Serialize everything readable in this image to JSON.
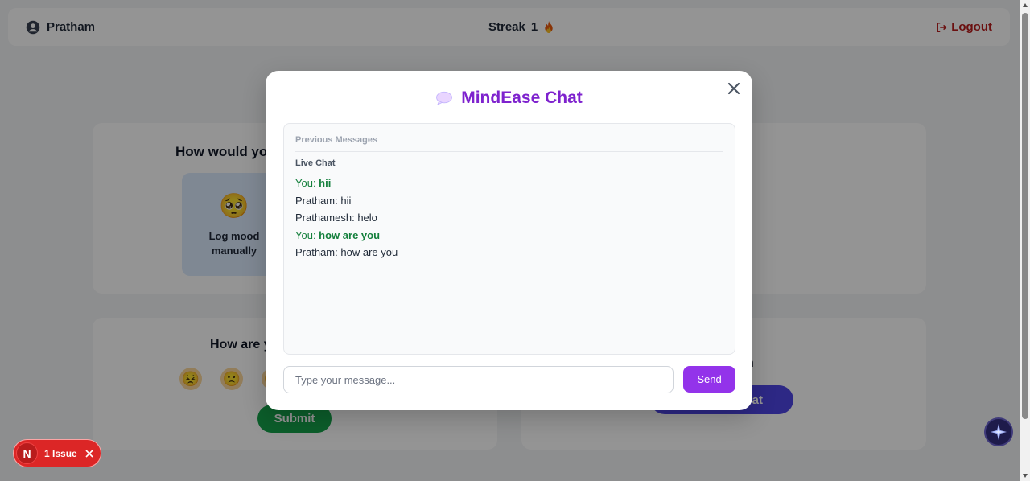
{
  "navbar": {
    "username": "Pratham",
    "streak_label": "Streak",
    "streak_count": "1",
    "streak_icon": "fire-icon",
    "logout_label": "Logout"
  },
  "mood_card": {
    "title": "How would you",
    "manual_emoji": "🥺",
    "manual_label": "Log mood manually"
  },
  "howare_card": {
    "title": "How are y",
    "faces": [
      "😣",
      "🙁",
      "😐"
    ],
    "submit_label": "Submit"
  },
  "chat_card": {
    "title": "n",
    "button_label": "at"
  },
  "modal": {
    "title": "MindEase Chat",
    "title_icon": "speech-bubble-icon",
    "previous_messages_label": "Previous Messages",
    "live_chat_label": "Live Chat",
    "messages": [
      {
        "sender": "You",
        "text": "hii",
        "mine": true
      },
      {
        "sender": "Pratham",
        "text": "hii",
        "mine": false
      },
      {
        "sender": "Prathamesh",
        "text": "helo",
        "mine": false
      },
      {
        "sender": "You",
        "text": "how are you",
        "mine": true
      },
      {
        "sender": "Pratham",
        "text": "how are you",
        "mine": false
      }
    ],
    "input_placeholder": "Type your message...",
    "input_value": "",
    "send_label": "Send"
  },
  "issue_badge": {
    "logo": "N",
    "text": "1 Issue"
  },
  "colors": {
    "accent_purple": "#7e22ce",
    "send_button": "#9333ea",
    "own_message": "#15803d",
    "logout": "#b91c1c",
    "submit_green": "#16a34a"
  }
}
